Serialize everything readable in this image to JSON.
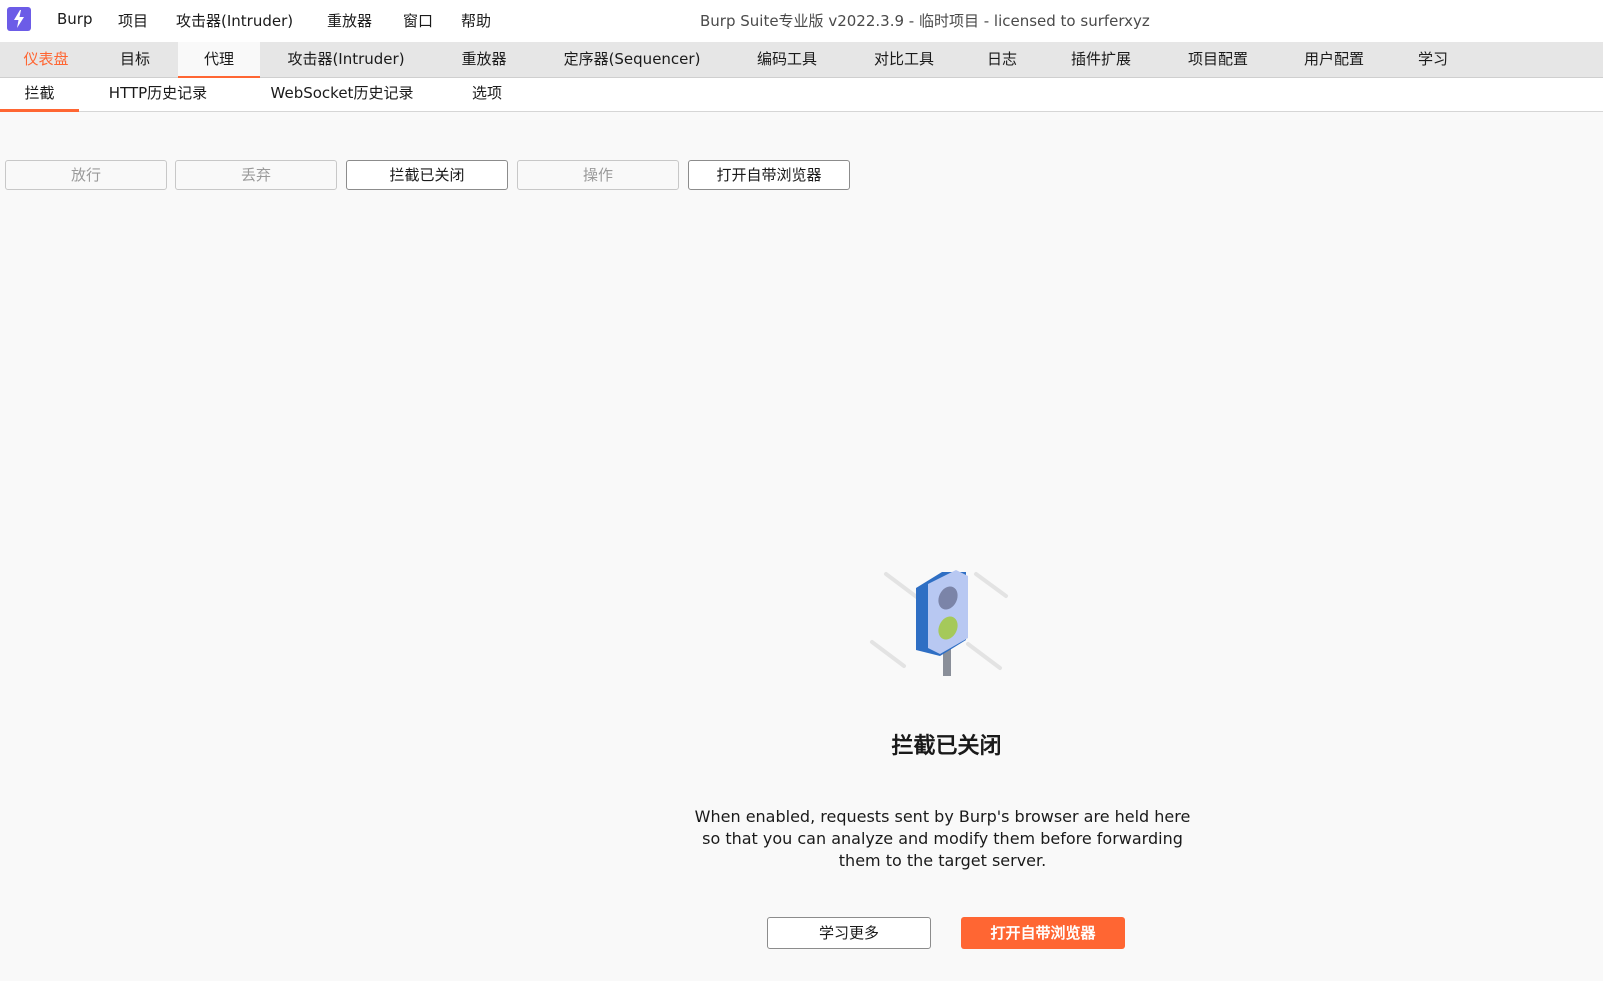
{
  "menubar": {
    "items": [
      "Burp",
      "项目",
      "攻击器(Intruder)",
      "重放器",
      "窗口",
      "帮助"
    ],
    "window_title": "Burp Suite专业版  v2022.3.9 - 临时项目 - licensed to surferxyz"
  },
  "main_tabs": [
    "仪表盘",
    "目标",
    "代理",
    "攻击器(Intruder)",
    "重放器",
    "定序器(Sequencer)",
    "编码工具",
    "对比工具",
    "日志",
    "插件扩展",
    "项目配置",
    "用户配置",
    "学习"
  ],
  "main_tab_selected": "代理",
  "sub_tabs": [
    "拦截",
    "HTTP历史记录",
    "WebSocket历史记录",
    "选项"
  ],
  "sub_tab_selected": "拦截",
  "toolbar": {
    "forward": "放行",
    "drop": "丢弃",
    "intercept_toggle": "拦截已关闭",
    "action": "操作",
    "open_browser": "打开自带浏览器"
  },
  "empty_state": {
    "title": "拦截已关闭",
    "description": "When enabled, requests sent by Burp's browser are held here so that you can analyze and modify them before forwarding them to the target server.",
    "learn_more": "学习更多",
    "open_browser": "打开自带浏览器",
    "illustration_icon": "traffic-light-icon"
  },
  "colors": {
    "accent": "#ff6633",
    "logo": "#6c5ce7"
  }
}
